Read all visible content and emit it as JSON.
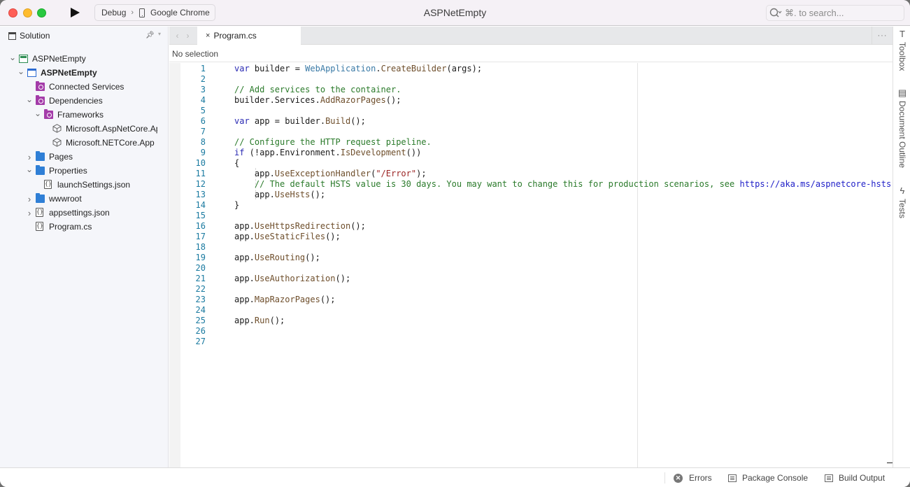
{
  "titlebar": {
    "title": "ASPNetEmpty",
    "run_config": "Debug",
    "run_separator": "›",
    "run_target": "Google Chrome",
    "search_placeholder": "⌘. to search..."
  },
  "sidebar": {
    "title": "Solution",
    "tree": [
      {
        "label": "ASPNetEmpty",
        "level": 0,
        "expander": "open",
        "icon": "solution-icon",
        "bold": false
      },
      {
        "label": "ASPNetEmpty",
        "level": 1,
        "expander": "open",
        "icon": "project-icon",
        "bold": true
      },
      {
        "label": "Connected Services",
        "level": 2,
        "expander": "none",
        "icon": "connected-services-icon",
        "bold": false
      },
      {
        "label": "Dependencies",
        "level": 2,
        "expander": "open",
        "icon": "dependencies-icon",
        "bold": false
      },
      {
        "label": "Frameworks",
        "level": 3,
        "expander": "open",
        "icon": "frameworks-icon",
        "bold": false
      },
      {
        "label": "Microsoft.AspNetCore.App",
        "level": 4,
        "expander": "none",
        "icon": "package-icon",
        "bold": false
      },
      {
        "label": "Microsoft.NETCore.App",
        "level": 4,
        "expander": "none",
        "icon": "package-icon",
        "bold": false
      },
      {
        "label": "Pages",
        "level": 2,
        "expander": "closed",
        "icon": "folder-icon",
        "bold": false
      },
      {
        "label": "Properties",
        "level": 2,
        "expander": "open",
        "icon": "folder-icon",
        "bold": false
      },
      {
        "label": "launchSettings.json",
        "level": 3,
        "expander": "none",
        "icon": "json-file-icon",
        "bold": false
      },
      {
        "label": "wwwroot",
        "level": 2,
        "expander": "closed",
        "icon": "folder-icon",
        "bold": false
      },
      {
        "label": "appsettings.json",
        "level": 2,
        "expander": "closed",
        "icon": "json-file-icon",
        "bold": false
      },
      {
        "label": "Program.cs",
        "level": 2,
        "expander": "none",
        "icon": "json-file-icon",
        "bold": false
      }
    ]
  },
  "editor": {
    "tab_label": "Program.cs",
    "tab_close": "×",
    "nav_back": "‹",
    "nav_forward": "›",
    "more": "···",
    "path_bar": "No selection",
    "lines": [
      {
        "n": "1",
        "tokens": [
          [
            "k",
            "var"
          ],
          [
            "p",
            " builder = "
          ],
          [
            "t",
            "WebApplication"
          ],
          [
            "p",
            "."
          ],
          [
            "m",
            "CreateBuilder"
          ],
          [
            "p",
            "(args);"
          ]
        ]
      },
      {
        "n": "2",
        "tokens": []
      },
      {
        "n": "3",
        "tokens": [
          [
            "c",
            "// Add services to the container."
          ]
        ]
      },
      {
        "n": "4",
        "tokens": [
          [
            "p",
            "builder.Services."
          ],
          [
            "m",
            "AddRazorPages"
          ],
          [
            "p",
            "();"
          ]
        ]
      },
      {
        "n": "5",
        "tokens": []
      },
      {
        "n": "6",
        "tokens": [
          [
            "k",
            "var"
          ],
          [
            "p",
            " app = builder."
          ],
          [
            "m",
            "Build"
          ],
          [
            "p",
            "();"
          ]
        ]
      },
      {
        "n": "7",
        "tokens": []
      },
      {
        "n": "8",
        "tokens": [
          [
            "c",
            "// Configure the HTTP request pipeline."
          ]
        ]
      },
      {
        "n": "9",
        "tokens": [
          [
            "k",
            "if"
          ],
          [
            "p",
            " (!app.Environment."
          ],
          [
            "m",
            "IsDevelopment"
          ],
          [
            "p",
            "())"
          ]
        ]
      },
      {
        "n": "10",
        "tokens": [
          [
            "p",
            "{"
          ]
        ]
      },
      {
        "n": "11",
        "tokens": [
          [
            "p",
            "    app."
          ],
          [
            "m",
            "UseExceptionHandler"
          ],
          [
            "p",
            "("
          ],
          [
            "s",
            "\"/Error\""
          ],
          [
            "p",
            ");"
          ]
        ]
      },
      {
        "n": "12",
        "tokens": [
          [
            "c",
            "    // The default HSTS value is 30 days. You may want to change this for production scenarios, see "
          ],
          [
            "u",
            "https://aka.ms/aspnetcore-hsts"
          ]
        ]
      },
      {
        "n": "13",
        "tokens": [
          [
            "p",
            "    app."
          ],
          [
            "m",
            "UseHsts"
          ],
          [
            "p",
            "();"
          ]
        ]
      },
      {
        "n": "14",
        "tokens": [
          [
            "p",
            "}"
          ]
        ]
      },
      {
        "n": "15",
        "tokens": []
      },
      {
        "n": "16",
        "tokens": [
          [
            "p",
            "app."
          ],
          [
            "m",
            "UseHttpsRedirection"
          ],
          [
            "p",
            "();"
          ]
        ]
      },
      {
        "n": "17",
        "tokens": [
          [
            "p",
            "app."
          ],
          [
            "m",
            "UseStaticFiles"
          ],
          [
            "p",
            "();"
          ]
        ]
      },
      {
        "n": "18",
        "tokens": []
      },
      {
        "n": "19",
        "tokens": [
          [
            "p",
            "app."
          ],
          [
            "m",
            "UseRouting"
          ],
          [
            "p",
            "();"
          ]
        ]
      },
      {
        "n": "20",
        "tokens": []
      },
      {
        "n": "21",
        "tokens": [
          [
            "p",
            "app."
          ],
          [
            "m",
            "UseAuthorization"
          ],
          [
            "p",
            "();"
          ]
        ]
      },
      {
        "n": "22",
        "tokens": []
      },
      {
        "n": "23",
        "tokens": [
          [
            "p",
            "app."
          ],
          [
            "m",
            "MapRazorPages"
          ],
          [
            "p",
            "();"
          ]
        ]
      },
      {
        "n": "24",
        "tokens": []
      },
      {
        "n": "25",
        "tokens": [
          [
            "p",
            "app."
          ],
          [
            "m",
            "Run"
          ],
          [
            "p",
            "();"
          ]
        ]
      },
      {
        "n": "26",
        "tokens": []
      },
      {
        "n": "27",
        "tokens": []
      }
    ]
  },
  "right_pads": {
    "toolbox": "Toolbox",
    "document_outline": "Document Outline",
    "tests": "Tests"
  },
  "statusbar": {
    "errors": "Errors",
    "package_console": "Package Console",
    "build_output": "Build Output"
  }
}
